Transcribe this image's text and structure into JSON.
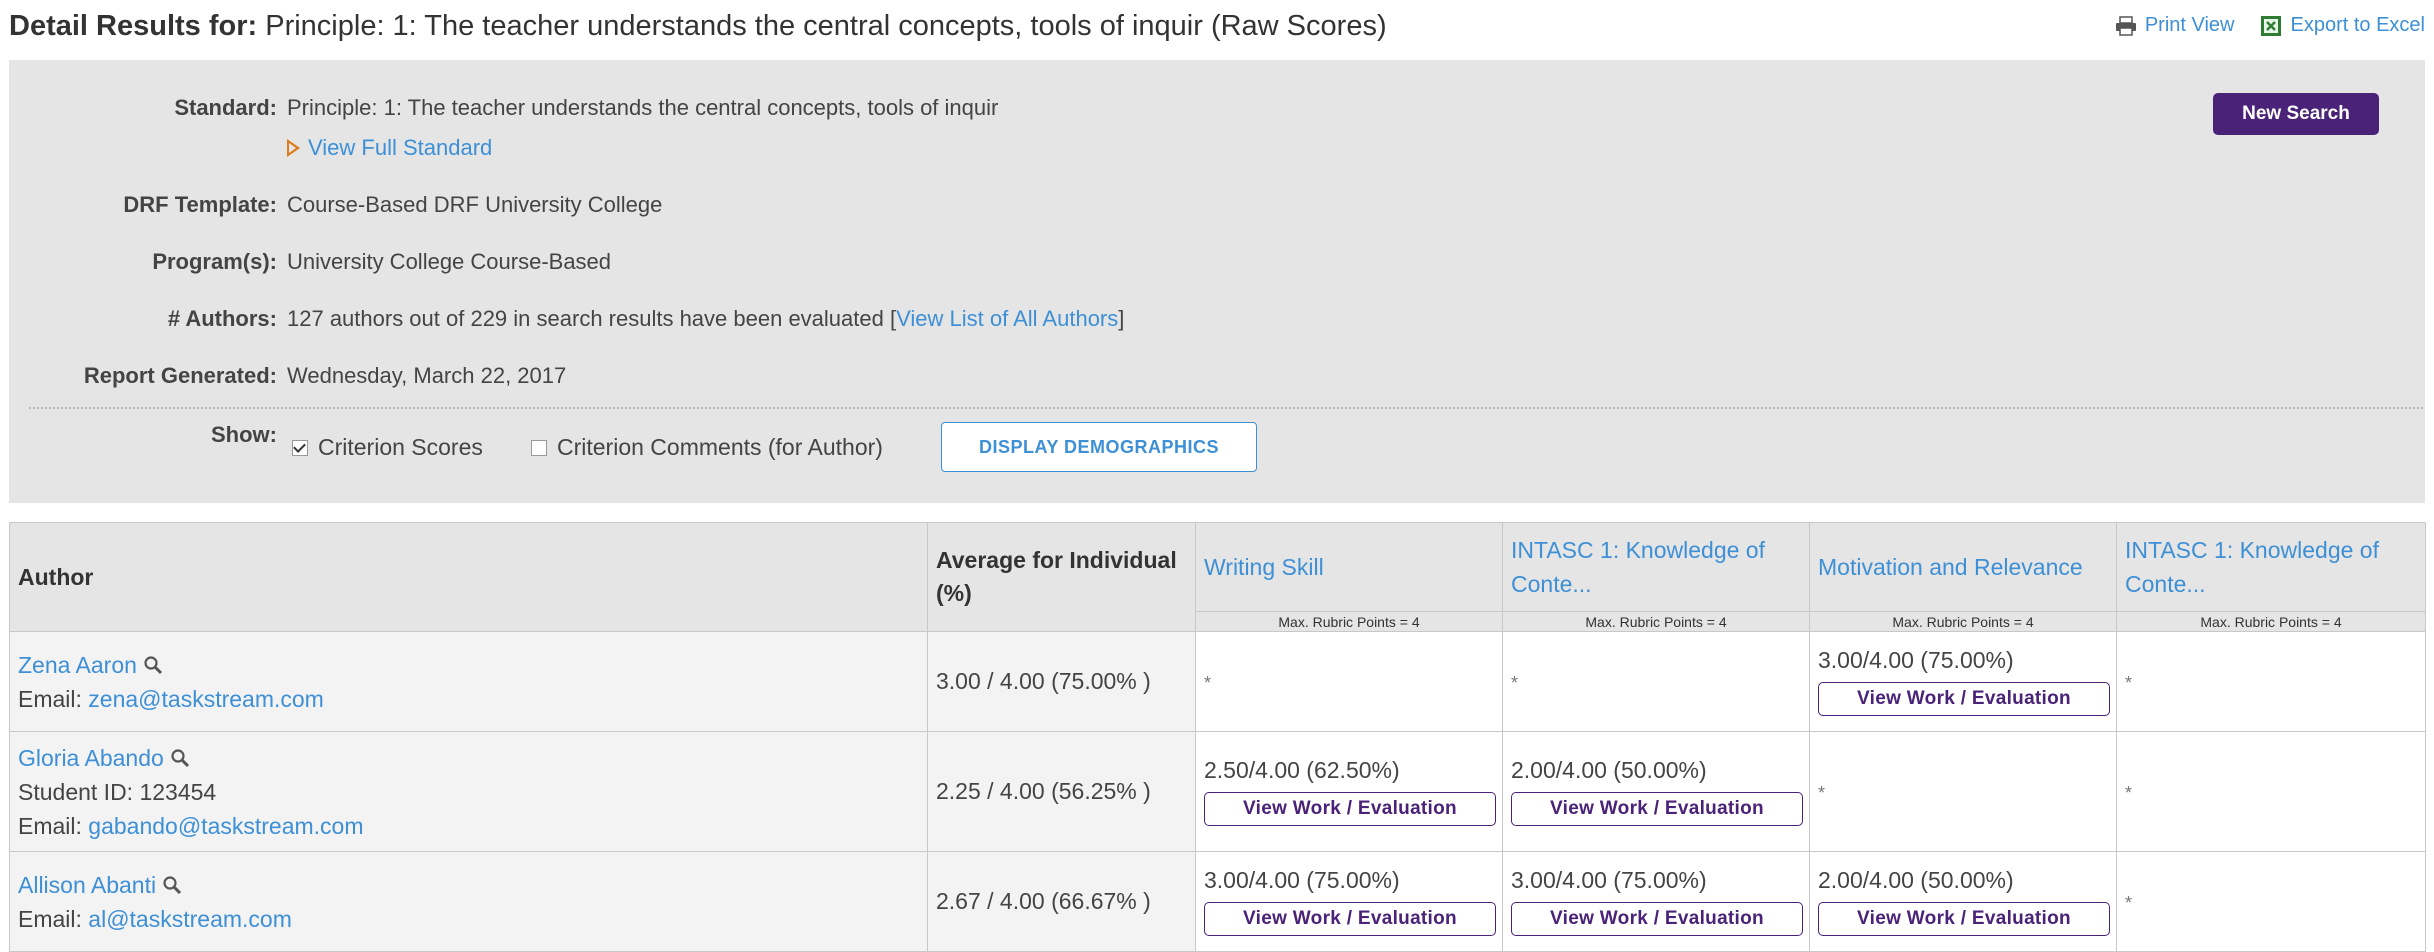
{
  "header": {
    "title_bold": "Detail Results for:",
    "title_rest": " Principle: 1: The teacher understands the central concepts, tools of inquir (Raw Scores)",
    "print_view": "Print View",
    "export_excel": "Export to Excel"
  },
  "info": {
    "standard_label": "Standard:",
    "standard_value": "Principle: 1: The teacher understands the central concepts, tools of inquir",
    "view_full_standard": "View Full Standard",
    "template_label": "DRF Template:",
    "template_value": "Course-Based DRF University College",
    "programs_label": "Program(s):",
    "programs_value": "University College Course-Based",
    "authors_label": "# Authors:",
    "authors_value": "127 authors out of 229 in search results have been evaluated [",
    "authors_link": "View List of All Authors",
    "authors_close": "]",
    "generated_label": "Report Generated:",
    "generated_value": "Wednesday, March 22, 2017",
    "new_search": "New Search"
  },
  "show": {
    "label": "Show:",
    "criterion_scores": "Criterion Scores",
    "criterion_scores_checked": true,
    "criterion_comments": "Criterion Comments (for Author)",
    "criterion_comments_checked": false,
    "display_demographics": "DISPLAY DEMOGRAPHICS"
  },
  "table": {
    "author_header": "Author",
    "avg_header": "Average for Individual (%)",
    "criteria": [
      {
        "title": "Writing Skill",
        "max": "Max. Rubric Points = 4"
      },
      {
        "title": "INTASC 1: Knowledge of Conte...",
        "max": "Max. Rubric Points = 4"
      },
      {
        "title": "Motivation and Relevance",
        "max": "Max. Rubric Points = 4"
      },
      {
        "title": "INTASC 1: Knowledge of Conte...",
        "max": "Max. Rubric Points = 4"
      }
    ],
    "view_btn": "View Work / Evaluation",
    "empty_mark": "*",
    "rows": [
      {
        "name": "Zena Aaron",
        "email_label": "Email: ",
        "email": "zena@taskstream.com",
        "average": "3.00 / 4.00  (75.00% )",
        "scores": [
          "*",
          "*",
          "3.00/4.00 (75.00%)",
          "*"
        ]
      },
      {
        "name": "Gloria Abando",
        "student_id": "Student ID: 123454",
        "email_label": "Email: ",
        "email": "gabando@taskstream.com",
        "average": "2.25 / 4.00  (56.25% )",
        "scores": [
          "2.50/4.00 (62.50%)",
          "2.00/4.00 (50.00%)",
          "*",
          "*"
        ]
      },
      {
        "name": "Allison Abanti",
        "email_label": "Email: ",
        "email": "al@taskstream.com",
        "average": "2.67 / 4.00  (66.67% )",
        "scores": [
          "3.00/4.00 (75.00%)",
          "3.00/4.00 (75.00%)",
          "2.00/4.00 (50.00%)",
          "*"
        ]
      }
    ]
  }
}
